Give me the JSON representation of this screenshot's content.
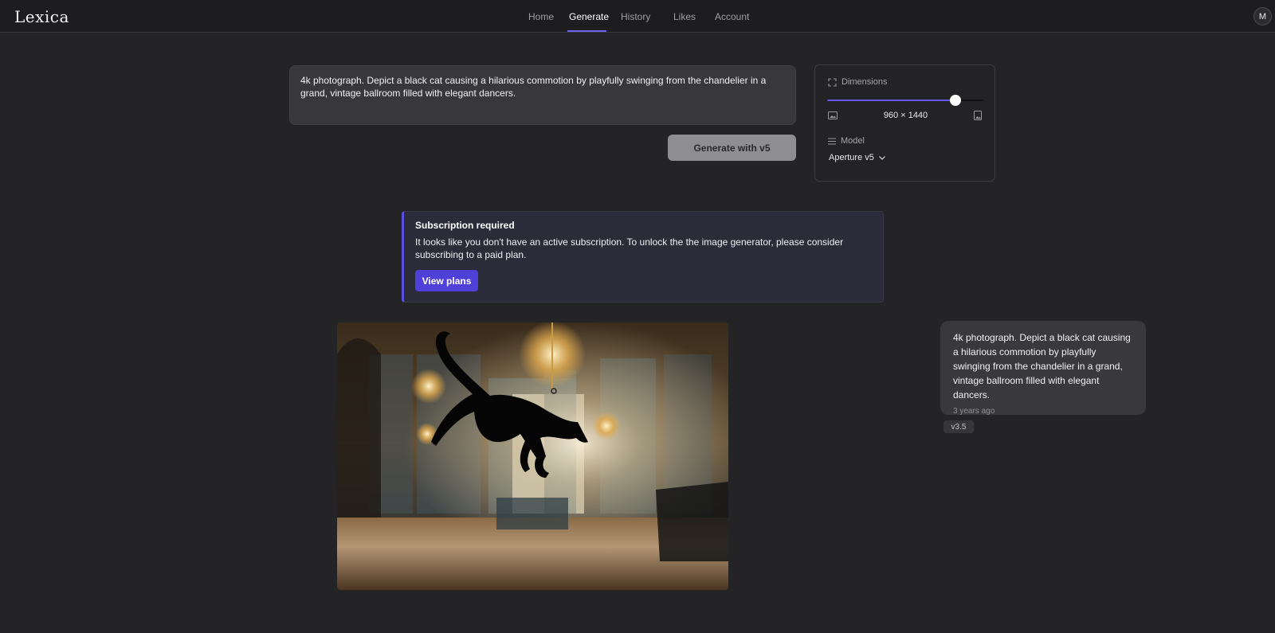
{
  "app": {
    "logo": "Lexica"
  },
  "nav": {
    "items": [
      {
        "label": "Home",
        "active": false
      },
      {
        "label": "Generate",
        "active": true
      },
      {
        "label": "History",
        "active": false
      },
      {
        "label": "Likes",
        "active": false
      },
      {
        "label": "Account",
        "active": false
      }
    ]
  },
  "user": {
    "avatar_initial": "M"
  },
  "prompt": {
    "text": "4k photograph. Depict a black cat causing a hilarious commotion by playfully swinging from the chandelier in a grand, vintage ballroom filled with elegant dancers."
  },
  "generate": {
    "button_label": "Generate with v5"
  },
  "settings": {
    "dimensions_label": "Dimensions",
    "dimensions_value": "960 × 1440",
    "slider_fraction": 0.82,
    "model_label": "Model",
    "model_value": "Aperture v5",
    "icons": {
      "dimensions": "expand-icon",
      "landscape": "image-landscape-icon",
      "portrait": "image-portrait-icon",
      "model": "list-icon",
      "dropdown": "chevron-down-icon"
    }
  },
  "alert": {
    "title": "Subscription required",
    "body": "It looks like you don't have an active subscription. To unlock the the image generator, please consider subscribing to a paid plan.",
    "button_label": "View plans"
  },
  "result": {
    "image_subject": "black-cat-chandelier-ballroom",
    "prompt_text": "4k photograph. Depict a black cat causing a hilarious commotion by playfully swinging from the chandelier in a grand, vintage ballroom filled with elegant dancers.",
    "time_ago": "3 years ago",
    "version": "v3.5"
  },
  "colors": {
    "accent": "#5a4fe3",
    "background": "#242426"
  }
}
